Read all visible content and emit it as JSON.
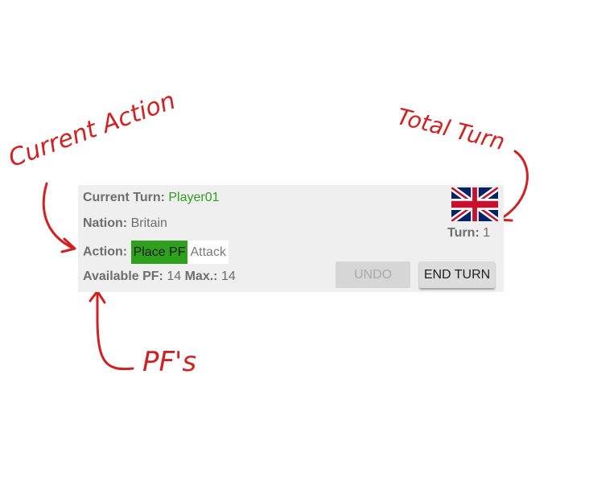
{
  "annotations": {
    "current_action": "Current Action",
    "total_turn": "Total Turn",
    "pfs": "PF's"
  },
  "status": {
    "current_turn_label": "Current Turn:",
    "current_turn_value": "Player01",
    "nation_label": "Nation:",
    "nation_value": "Britain",
    "action_label": "Action:",
    "actions": [
      {
        "label": "Place PF",
        "active": true
      },
      {
        "label": "Attack",
        "active": false
      }
    ],
    "available_pf_label": "Available PF:",
    "available_pf_value": "14",
    "max_label": "Max.:",
    "max_value": "14",
    "turn_label": "Turn:",
    "turn_value": "1"
  },
  "buttons": {
    "undo": "UNDO",
    "end_turn": "END TURN"
  },
  "flag_icon": "union-jack-flag-icon",
  "colors": {
    "player_name": "#2e9e1e",
    "active_action_bg": "#2ea01e",
    "annotation": "#d32020",
    "panel_bg": "#efefef"
  }
}
